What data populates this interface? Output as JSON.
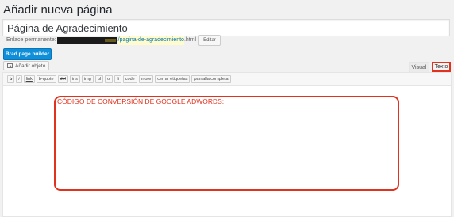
{
  "page": {
    "heading": "Añadir nueva página"
  },
  "title_input": {
    "value": "Página de Agradecimiento"
  },
  "permalink": {
    "label": "Enlace permanente:",
    "slug": "/pagina-de-agradecimiento",
    "suffix": ".html",
    "edit_label": "Editar"
  },
  "builder_button": {
    "label": "Brad page builder"
  },
  "media_button": {
    "label": "Añadir objeto",
    "icon": "media-icon"
  },
  "tabs": {
    "visual": "Visual",
    "text": "Texto"
  },
  "toolbar": {
    "buttons": [
      "b",
      "i",
      "link",
      "b-quote",
      "del",
      "ins",
      "img",
      "ul",
      "ol",
      "li",
      "code",
      "more",
      "cerrar etiquetas",
      "pantalla completa"
    ]
  },
  "content": {
    "annotation_text": "CÓDIGO DE CONVERSIÓN DE GOOGLE ADWORDS:"
  },
  "colors": {
    "highlight": "#e0321e",
    "builder_button": "#0f8fd9"
  }
}
